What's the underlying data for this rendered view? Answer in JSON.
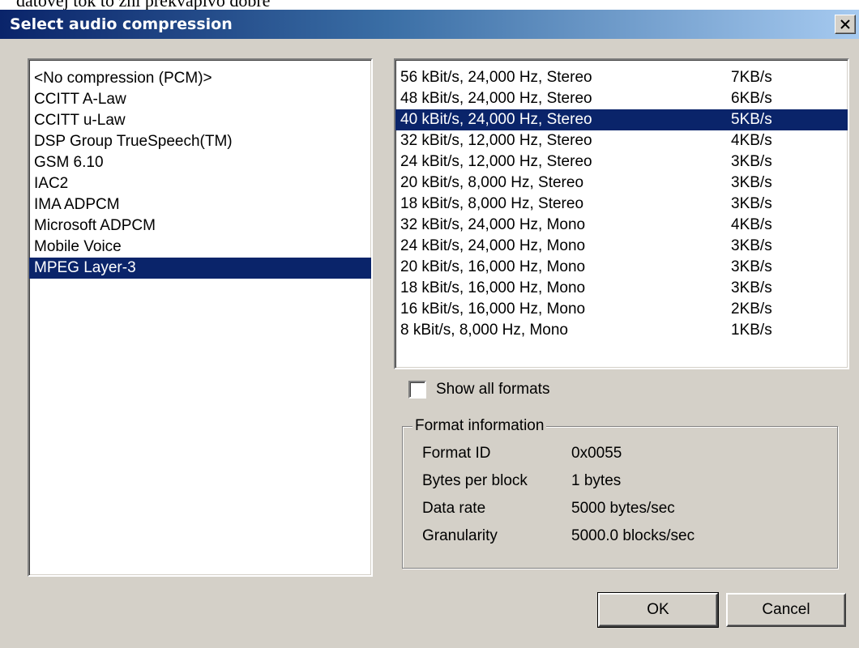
{
  "background_text": "datovej tok to zní prekvapivo dobre",
  "window": {
    "title": "Select audio compression",
    "close_icon": "close-icon"
  },
  "codecs": [
    "<No compression (PCM)>",
    "CCITT A-Law",
    "CCITT u-Law",
    "DSP Group TrueSpeech(TM)",
    "GSM 6.10",
    "IAC2",
    "IMA ADPCM",
    "Microsoft ADPCM",
    "Mobile Voice",
    "MPEG Layer-3"
  ],
  "selected_codec": "MPEG Layer-3",
  "formats": [
    {
      "label": "56 kBit/s, 24,000 Hz, Stereo",
      "rate": "7KB/s"
    },
    {
      "label": "48 kBit/s, 24,000 Hz, Stereo",
      "rate": "6KB/s"
    },
    {
      "label": "40 kBit/s, 24,000 Hz, Stereo",
      "rate": "5KB/s"
    },
    {
      "label": "32 kBit/s, 12,000 Hz, Stereo",
      "rate": "4KB/s"
    },
    {
      "label": "24 kBit/s, 12,000 Hz, Stereo",
      "rate": "3KB/s"
    },
    {
      "label": "20 kBit/s, 8,000 Hz, Stereo",
      "rate": "3KB/s"
    },
    {
      "label": "18 kBit/s, 8,000 Hz, Stereo",
      "rate": "3KB/s"
    },
    {
      "label": "32 kBit/s, 24,000 Hz, Mono",
      "rate": "4KB/s"
    },
    {
      "label": "24 kBit/s, 24,000 Hz, Mono",
      "rate": "3KB/s"
    },
    {
      "label": "20 kBit/s, 16,000 Hz, Mono",
      "rate": "3KB/s"
    },
    {
      "label": "18 kBit/s, 16,000 Hz, Mono",
      "rate": "3KB/s"
    },
    {
      "label": "16 kBit/s, 16,000 Hz, Mono",
      "rate": "2KB/s"
    },
    {
      "label": "8 kBit/s, 8,000 Hz, Mono",
      "rate": "1KB/s"
    }
  ],
  "selected_format": "40 kBit/s, 24,000 Hz, Stereo",
  "show_all_formats": {
    "label": "Show all formats",
    "checked": false
  },
  "format_info": {
    "legend": "Format information",
    "rows": [
      {
        "label": "Format ID",
        "value": "0x0055"
      },
      {
        "label": "Bytes per block",
        "value": "1 bytes"
      },
      {
        "label": "Data rate",
        "value": "5000 bytes/sec"
      },
      {
        "label": "Granularity",
        "value": "5000.0 blocks/sec"
      }
    ]
  },
  "buttons": {
    "ok": "OK",
    "cancel": "Cancel"
  },
  "colors": {
    "selection": "#0a246a",
    "face": "#d4d0c8"
  }
}
